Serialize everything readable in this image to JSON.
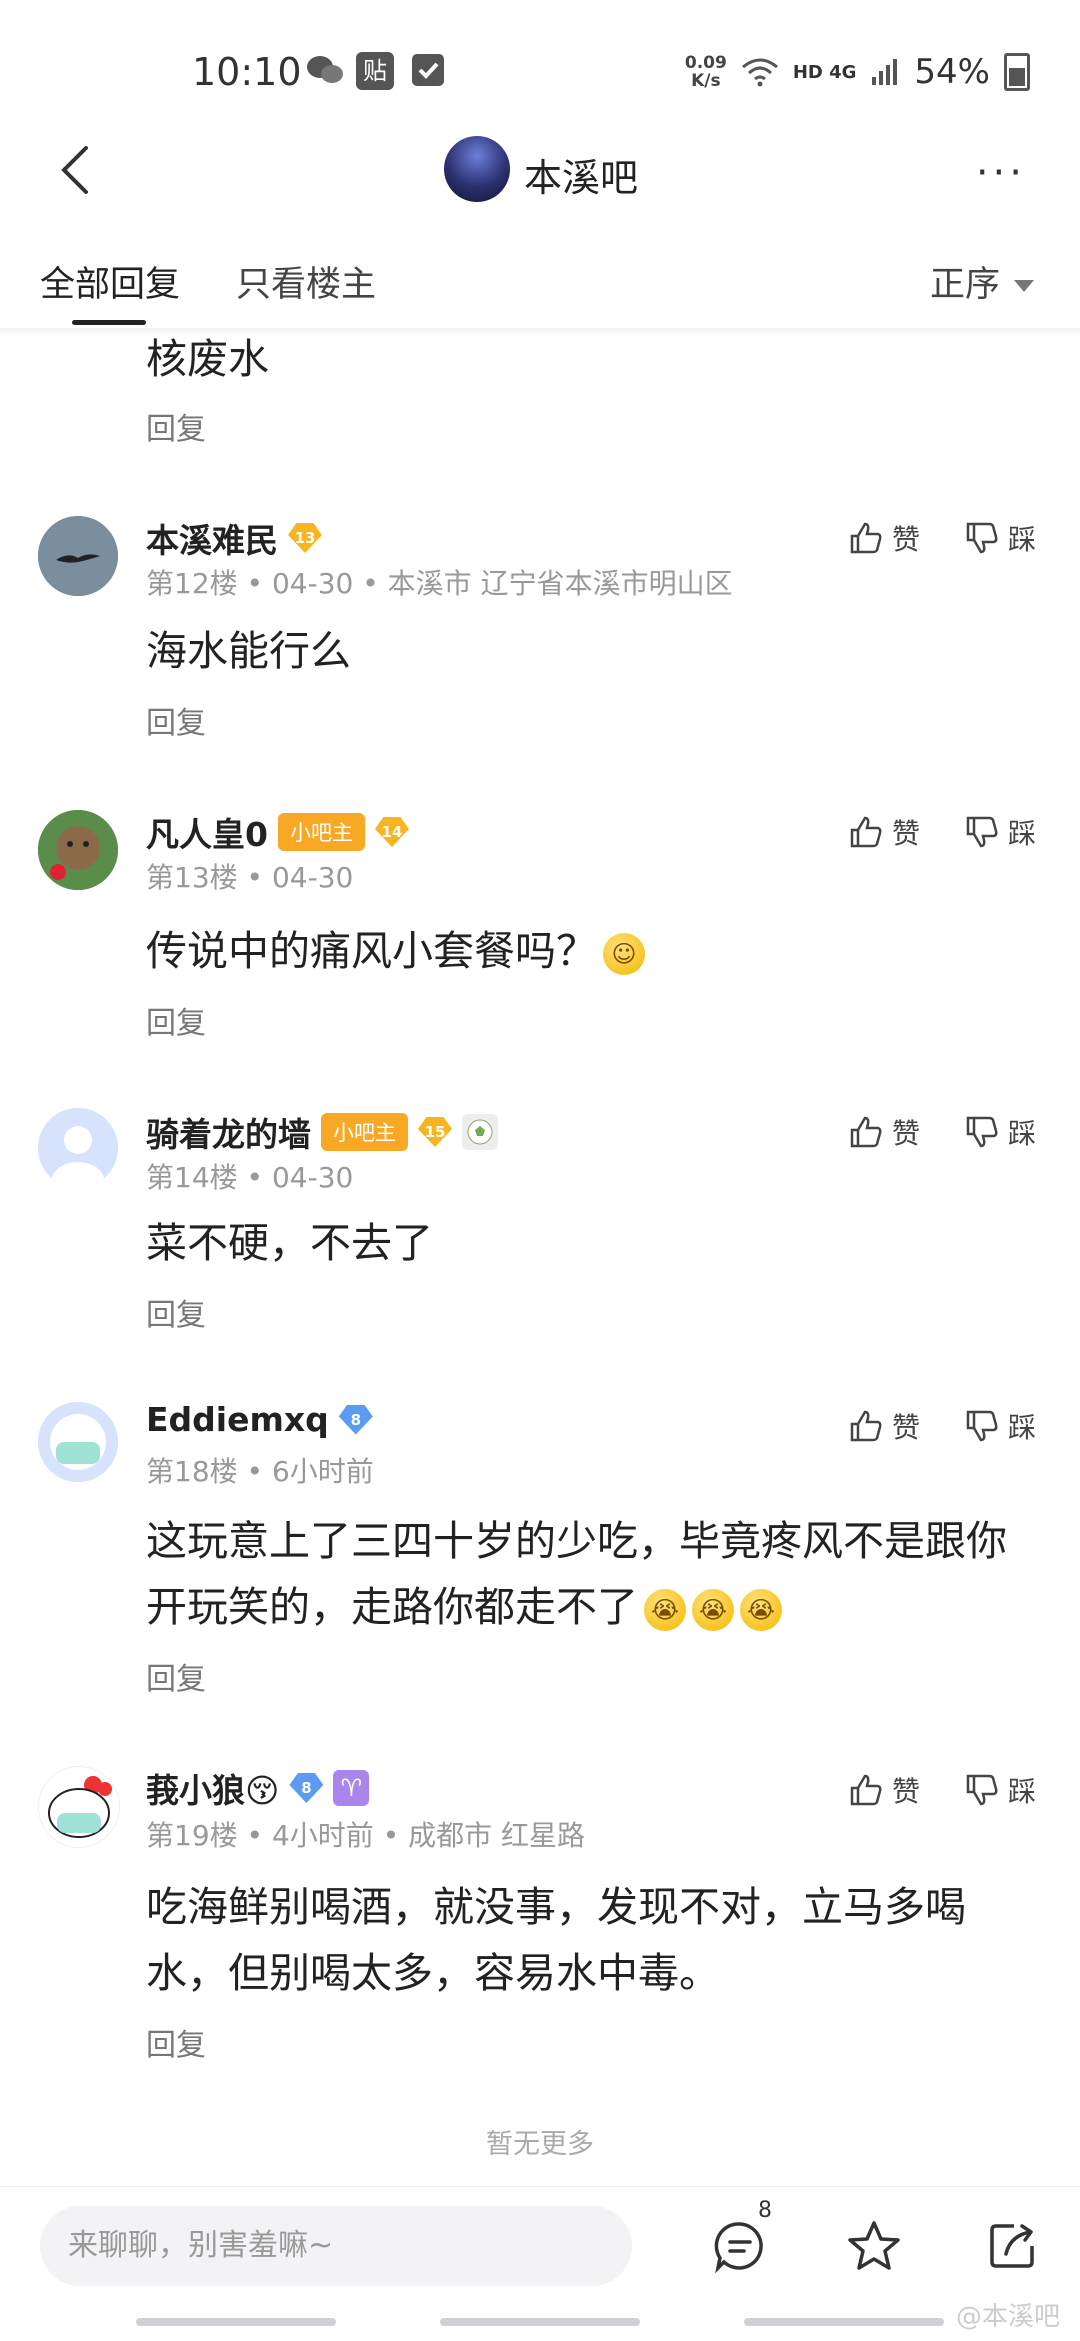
{
  "status_bar": {
    "time": "10:10",
    "speed_top": "0.09",
    "speed_bottom": "K/s",
    "network": "HD 4G",
    "battery": "54%",
    "paste_icon_label": "贴"
  },
  "header": {
    "forum_name": "本溪吧",
    "more": "···"
  },
  "tabs": {
    "all": "全部回复",
    "op_only": "只看楼主",
    "sort": "正序"
  },
  "top_partial": {
    "text": "核废水",
    "reply": "回复"
  },
  "posts": [
    {
      "user": "本溪难民",
      "level": "13",
      "floor": "第12楼",
      "date": "04-30",
      "location": "本溪市 辽宁省本溪市明山区",
      "text": "海水能行么",
      "reply": "回复",
      "like": "赞",
      "dislike": "踩"
    },
    {
      "user": "凡人皇0",
      "badge": "小吧主",
      "level": "14",
      "floor": "第13楼",
      "date": "04-30",
      "text": "传说中的痛风小套餐吗？",
      "reply": "回复",
      "like": "赞",
      "dislike": "踩"
    },
    {
      "user": "骑着龙的墙",
      "badge": "小吧主",
      "level": "15",
      "floor": "第14楼",
      "date": "04-30",
      "text": "菜不硬，不去了",
      "reply": "回复",
      "like": "赞",
      "dislike": "踩"
    },
    {
      "user": "Eddiemxq",
      "level": "8",
      "floor": "第18楼",
      "date": "6小时前",
      "text": "这玩意上了三四十岁的少吃，毕竟疼风不是跟你开玩笑的，走路你都走不了",
      "reply": "回复",
      "like": "赞",
      "dislike": "踩"
    },
    {
      "user": "莪小狼😚",
      "level": "8",
      "zodiac": "♈",
      "floor": "第19楼",
      "date": "4小时前",
      "location": "成都市 红星路",
      "text": "吃海鲜别喝酒，就没事，发现不对，立马多喝水，但别喝太多，容易水中毒。",
      "reply": "回复",
      "like": "赞",
      "dislike": "踩"
    }
  ],
  "separator": "•",
  "no_more": "暂无更多",
  "bottom_bar": {
    "input_placeholder": "来聊聊，别害羞嘛~",
    "comment_count": "8",
    "watermark": "@本溪吧"
  }
}
